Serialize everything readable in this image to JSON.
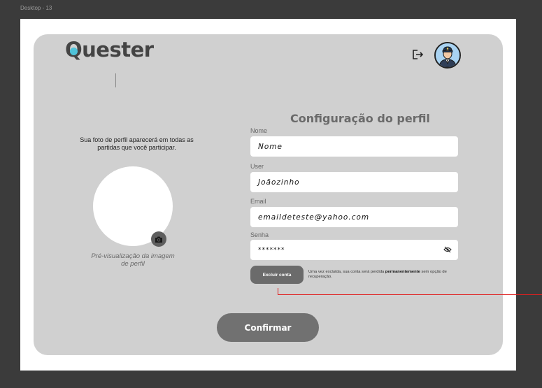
{
  "frame": {
    "label": "Desktop - 13"
  },
  "header": {
    "logo_text": "uester",
    "logo_first": "Q",
    "logout_icon": "logout-icon",
    "avatar_icon": "user-avatar"
  },
  "profile_photo": {
    "description": "Sua foto de perfil aparecerá em todas as partidas que você participar.",
    "caption": "Pré-visualização da imagem de perfil",
    "camera_icon": "camera-icon"
  },
  "form": {
    "title": "Configuração do perfil",
    "fields": [
      {
        "label": "Nome",
        "value": "Nome"
      },
      {
        "label": "User",
        "value": "Joãozinho"
      },
      {
        "label": "Email",
        "value": "emaildeteste@yahoo.com"
      },
      {
        "label": "Senha",
        "value": "*******"
      }
    ],
    "password_toggle_icon": "eye-off-icon"
  },
  "delete_account": {
    "button_label": "Excluir conta",
    "note_before": "Uma vez excluída, sua conta será perdida ",
    "note_bold": "permanentemente",
    "note_after": " sem opção de recuperação."
  },
  "confirm": {
    "label": "Confirmar"
  },
  "colors": {
    "card": "#d0d0d0",
    "accent": "#4fc3d9",
    "button": "#717171",
    "annotation": "#e02020"
  }
}
